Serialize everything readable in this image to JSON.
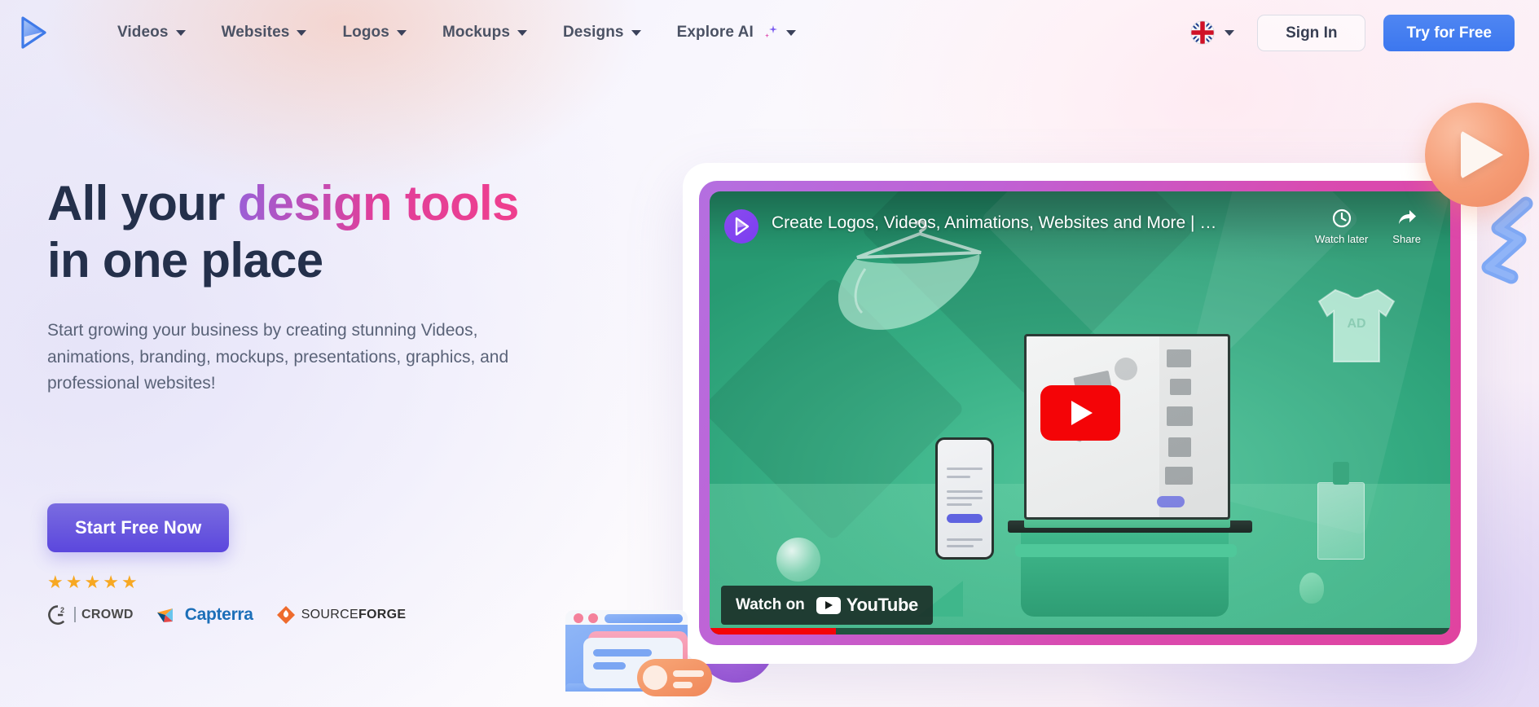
{
  "brand": {
    "logo_icon": "renderforest-play-logo"
  },
  "nav": {
    "items": [
      {
        "label": "Videos",
        "has_dropdown": true
      },
      {
        "label": "Websites",
        "has_dropdown": true
      },
      {
        "label": "Logos",
        "has_dropdown": true
      },
      {
        "label": "Mockups",
        "has_dropdown": true
      },
      {
        "label": "Designs",
        "has_dropdown": true
      },
      {
        "label": "Explore AI",
        "has_dropdown": true,
        "sparkle": true
      }
    ],
    "language": {
      "flag_icon": "uk-flag-icon",
      "caret_icon": "chevron-down-icon"
    },
    "sign_in_label": "Sign In",
    "try_free_label": "Try for Free"
  },
  "hero": {
    "headline_part1": "All your ",
    "headline_accent": "design tools",
    "headline_part2": "in one place",
    "subhead": "Start growing your business by creating stunning Videos, animations, branding, mockups, presentations, graphics, and professional websites!",
    "cta_label": "Start Free Now",
    "stars": "★★★★★",
    "star_count": 5,
    "review_logos": [
      {
        "name": "g2-crowd-logo",
        "mark": "G²",
        "text": "CROWD"
      },
      {
        "name": "capterra-logo",
        "text": "Capterra"
      },
      {
        "name": "sourceforge-logo",
        "text_light": "SOURCE",
        "text_bold": "FORGE"
      }
    ]
  },
  "video": {
    "title": "Create Logos, Videos, Animations, Websites and More | Re…",
    "channel_avatar_icon": "renderforest-channel-avatar",
    "watch_later_label": "Watch later",
    "watch_later_icon": "clock-icon",
    "share_label": "Share",
    "share_icon": "share-arrow-icon",
    "play_button_icon": "youtube-play-button",
    "watch_on_label": "Watch on",
    "youtube_wordmark": "YouTube",
    "youtube_icon": "youtube-icon"
  },
  "colors": {
    "accent_blue": "#3c77ef",
    "accent_purple": "#5b47dd",
    "headline_dark": "#24304b",
    "gradient_pink": "#df3f9b",
    "gradient_purple": "#9b5fd6",
    "youtube_red": "#f40407",
    "star_gold": "#f7a822",
    "video_green": "#38b085",
    "frame_magenta": "#d94bb0"
  },
  "decor": {
    "play_sphere_icon": "orange-play-sphere",
    "zigzag_icon": "blue-zigzag",
    "browser_icon": "browser-window-illustration",
    "peach_blob": "peach-blur-blob"
  }
}
